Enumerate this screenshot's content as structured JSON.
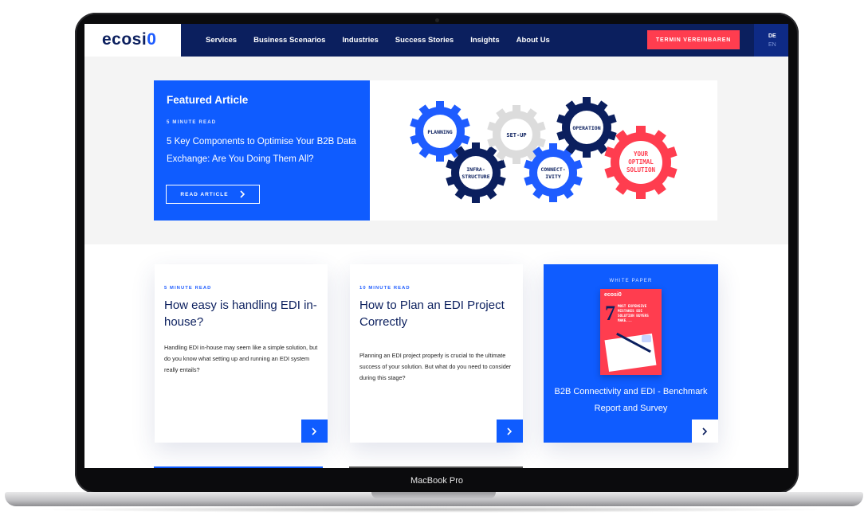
{
  "device": {
    "label": "MacBook Pro"
  },
  "nav": {
    "logo": {
      "text_main": "ecosi",
      "text_accent": "0"
    },
    "items": [
      "Services",
      "Business Scenarios",
      "Industries",
      "Success Stories",
      "Insights",
      "About Us"
    ],
    "cta_label": "TERMIN VEREINBAREN",
    "lang_active": "DE",
    "lang_other": "EN"
  },
  "featured": {
    "title": "Featured Article",
    "read_time": "5 MINUTE READ",
    "heading": "5 Key Components to Optimise Your B2B Data Exchange: Are You Doing Them All?",
    "button_label": "READ ARTICLE",
    "gears": [
      "PLANNING",
      "INFRA-",
      "STRUCTURE",
      "SET-UP",
      "CONNECT-",
      "IVITY",
      "OPERATION",
      "YOUR",
      "OPTIMAL",
      "SOLUTION"
    ]
  },
  "cards": [
    {
      "read_time": "5 MINUTE READ",
      "title": "How easy is handling EDI in-house?",
      "text": "Handling EDI in-house may seem like a simple solution, but do you know what setting up and running an EDI system really entails?"
    },
    {
      "read_time": "10 MINUTE READ",
      "title": "How to Plan an EDI Project Correctly",
      "text": "Planning an EDI project properly is crucial to the ultimate success of your solution. But what do you need to consider during this stage?"
    }
  ],
  "whitepaper": {
    "label": "WHITE PAPER",
    "cover_number": "7",
    "cover_brand": "ecosi0",
    "cover_text": "MOST EXPENSIVE MISTAKES EDI SOLUTION BUYERS MAKE...",
    "title": "B2B Connectivity and EDI - Benchmark Report and Survey"
  },
  "colors": {
    "navy": "#0b1f5e",
    "blue": "#0f5cff",
    "red": "#ff3d4f"
  }
}
